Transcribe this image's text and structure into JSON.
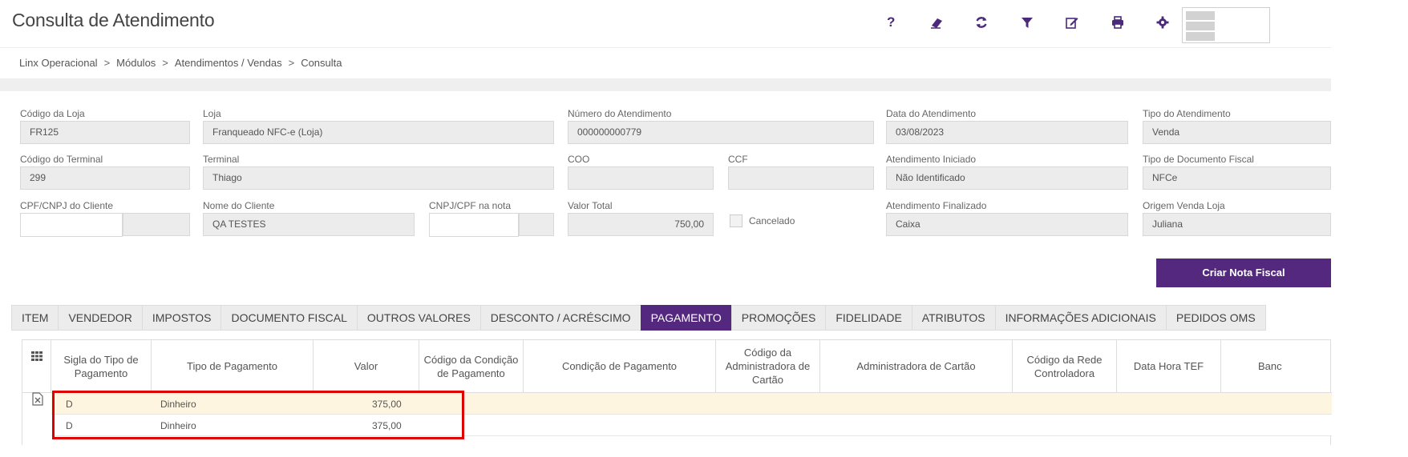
{
  "header": {
    "title": "Consulta de Atendimento",
    "toolbar": [
      {
        "icon": "help-icon",
        "label": "?"
      },
      {
        "icon": "eraser-icon"
      },
      {
        "icon": "refresh-icon"
      },
      {
        "icon": "filter-icon"
      },
      {
        "icon": "edit-icon"
      },
      {
        "icon": "print-icon"
      },
      {
        "icon": "gear-icon"
      }
    ]
  },
  "breadcrumb": [
    "Linx Operacional",
    "Módulos",
    "Atendimentos / Vendas",
    "Consulta"
  ],
  "breadcrumb_sep": ">",
  "form": {
    "codigo_loja": {
      "label": "Código da Loja",
      "value": "FR125"
    },
    "loja": {
      "label": "Loja",
      "value": "Franqueado NFC-e (Loja)"
    },
    "numero_atendimento": {
      "label": "Número do Atendimento",
      "value": "000000000779"
    },
    "data_atendimento": {
      "label": "Data do Atendimento",
      "value": "03/08/2023"
    },
    "tipo_atendimento": {
      "label": "Tipo do Atendimento",
      "value": "Venda"
    },
    "codigo_terminal": {
      "label": "Código do Terminal",
      "value": "299"
    },
    "terminal": {
      "label": "Terminal",
      "value": "Thiago"
    },
    "coo": {
      "label": "COO",
      "value": ""
    },
    "ccf": {
      "label": "CCF",
      "value": ""
    },
    "atendimento_iniciado": {
      "label": "Atendimento Iniciado",
      "value": "Não Identificado"
    },
    "tipo_documento_fiscal": {
      "label": "Tipo de Documento Fiscal",
      "value": "NFCe"
    },
    "cpf_cliente": {
      "label": "CPF/CNPJ do Cliente",
      "value": ""
    },
    "nome_cliente": {
      "label": "Nome do Cliente",
      "value": "QA TESTES"
    },
    "cpf_nota": {
      "label": "CNPJ/CPF na nota",
      "value": ""
    },
    "valor_total": {
      "label": "Valor Total",
      "value": "750,00"
    },
    "cancelado": {
      "label": "Cancelado",
      "checked": false
    },
    "atendimento_finalizado": {
      "label": "Atendimento Finalizado",
      "value": "Caixa"
    },
    "origem_venda_loja": {
      "label": "Origem Venda Loja",
      "value": "Juliana"
    },
    "criar_nota_fiscal": "Criar Nota Fiscal"
  },
  "tabs": [
    "ITEM",
    "VENDEDOR",
    "IMPOSTOS",
    "DOCUMENTO FISCAL",
    "OUTROS VALORES",
    "DESCONTO / ACRÉSCIMO",
    "PAGAMENTO",
    "PROMOÇÕES",
    "FIDELIDADE",
    "ATRIBUTOS",
    "INFORMAÇÕES ADICIONAIS",
    "PEDIDOS OMS"
  ],
  "active_tab": "PAGAMENTO",
  "grid": {
    "columns": [
      "Sigla do Tipo de Pagamento",
      "Tipo de Pagamento",
      "Valor",
      "Código da Condição de Pagamento",
      "Condição de Pagamento",
      "Código da Administradora de Cartão",
      "Administradora de Cartão",
      "Código da Rede Controladora",
      "Data Hora TEF",
      "Banc"
    ],
    "rows": [
      {
        "sigla": "D",
        "tipo": "Dinheiro",
        "valor": "375,00"
      },
      {
        "sigla": "D",
        "tipo": "Dinheiro",
        "valor": "375,00"
      }
    ]
  },
  "colors": {
    "accent": "#55287f",
    "highlight": "#dd0000",
    "row_highlight": "#fdf5e0"
  }
}
